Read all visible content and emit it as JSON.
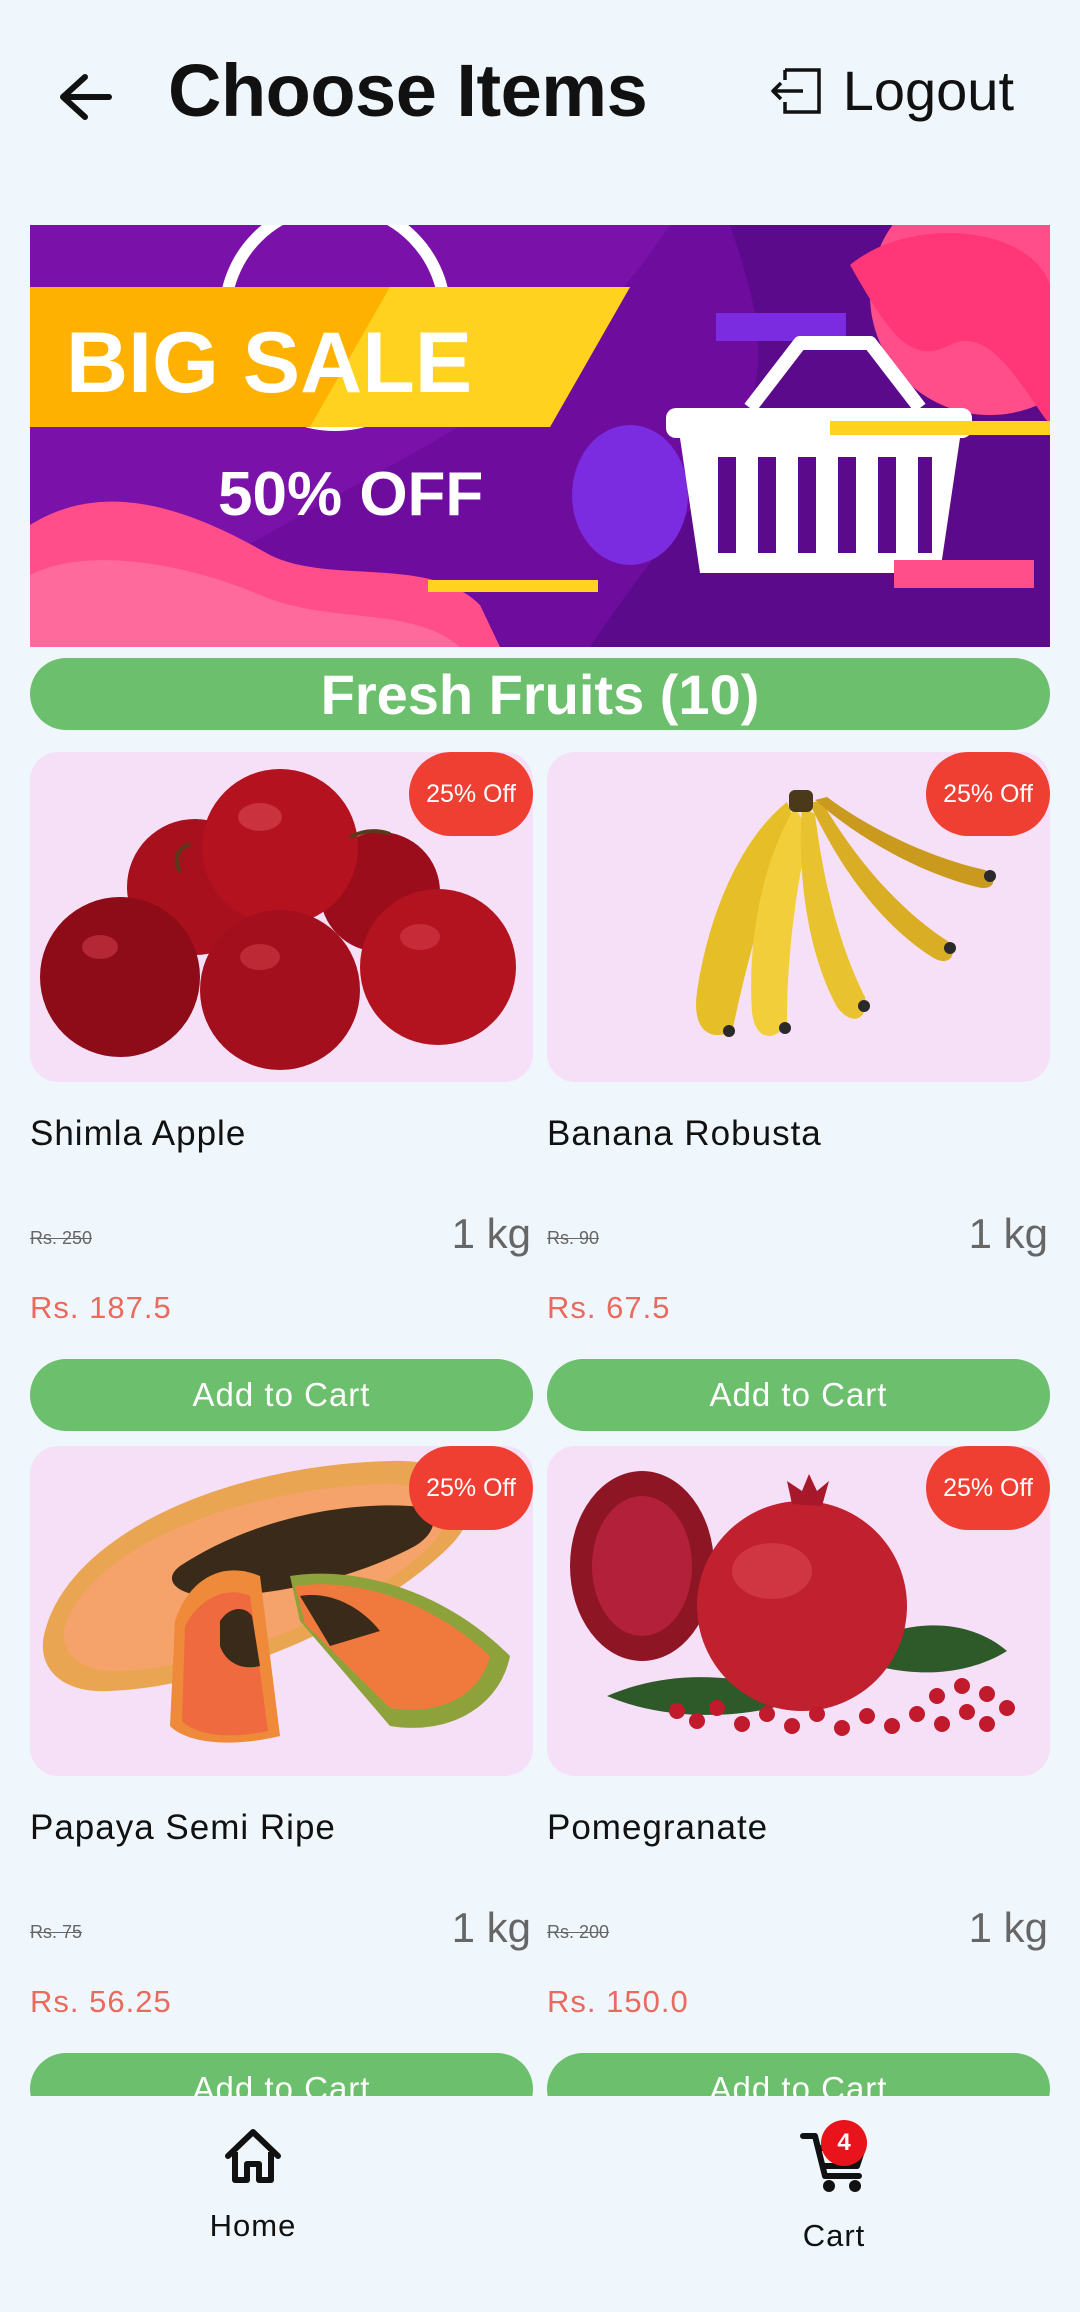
{
  "header": {
    "title": "Choose Items",
    "logout_label": "Logout"
  },
  "banner": {
    "headline": "BIG SALE",
    "subline": "50% OFF"
  },
  "category": {
    "label": "Fresh Fruits (10)"
  },
  "products": [
    {
      "name": "Shimla Apple",
      "badge": "25% Off",
      "old_price": "Rs. 250",
      "qty": "1 kg",
      "price": "Rs. 187.5",
      "button": "Add to Cart"
    },
    {
      "name": "Banana Robusta",
      "badge": "25% Off",
      "old_price": "Rs. 90",
      "qty": "1 kg",
      "price": "Rs. 67.5",
      "button": "Add to Cart"
    },
    {
      "name": "Papaya Semi Ripe",
      "badge": "25% Off",
      "old_price": "Rs. 75",
      "qty": "1 kg",
      "price": "Rs. 56.25",
      "button": "Add to Cart"
    },
    {
      "name": "Pomegranate",
      "badge": "25% Off",
      "old_price": "Rs. 200",
      "qty": "1 kg",
      "price": "Rs. 150.0",
      "button": "Add to Cart"
    }
  ],
  "bottom_nav": {
    "home_label": "Home",
    "cart_label": "Cart",
    "cart_count": "4"
  },
  "colors": {
    "accent_green": "#6CBF6C",
    "badge_red": "#EF3F33",
    "price_red": "#EA6A5E",
    "card_bg": "#F5E0F7",
    "page_bg": "#F0F7FC"
  }
}
